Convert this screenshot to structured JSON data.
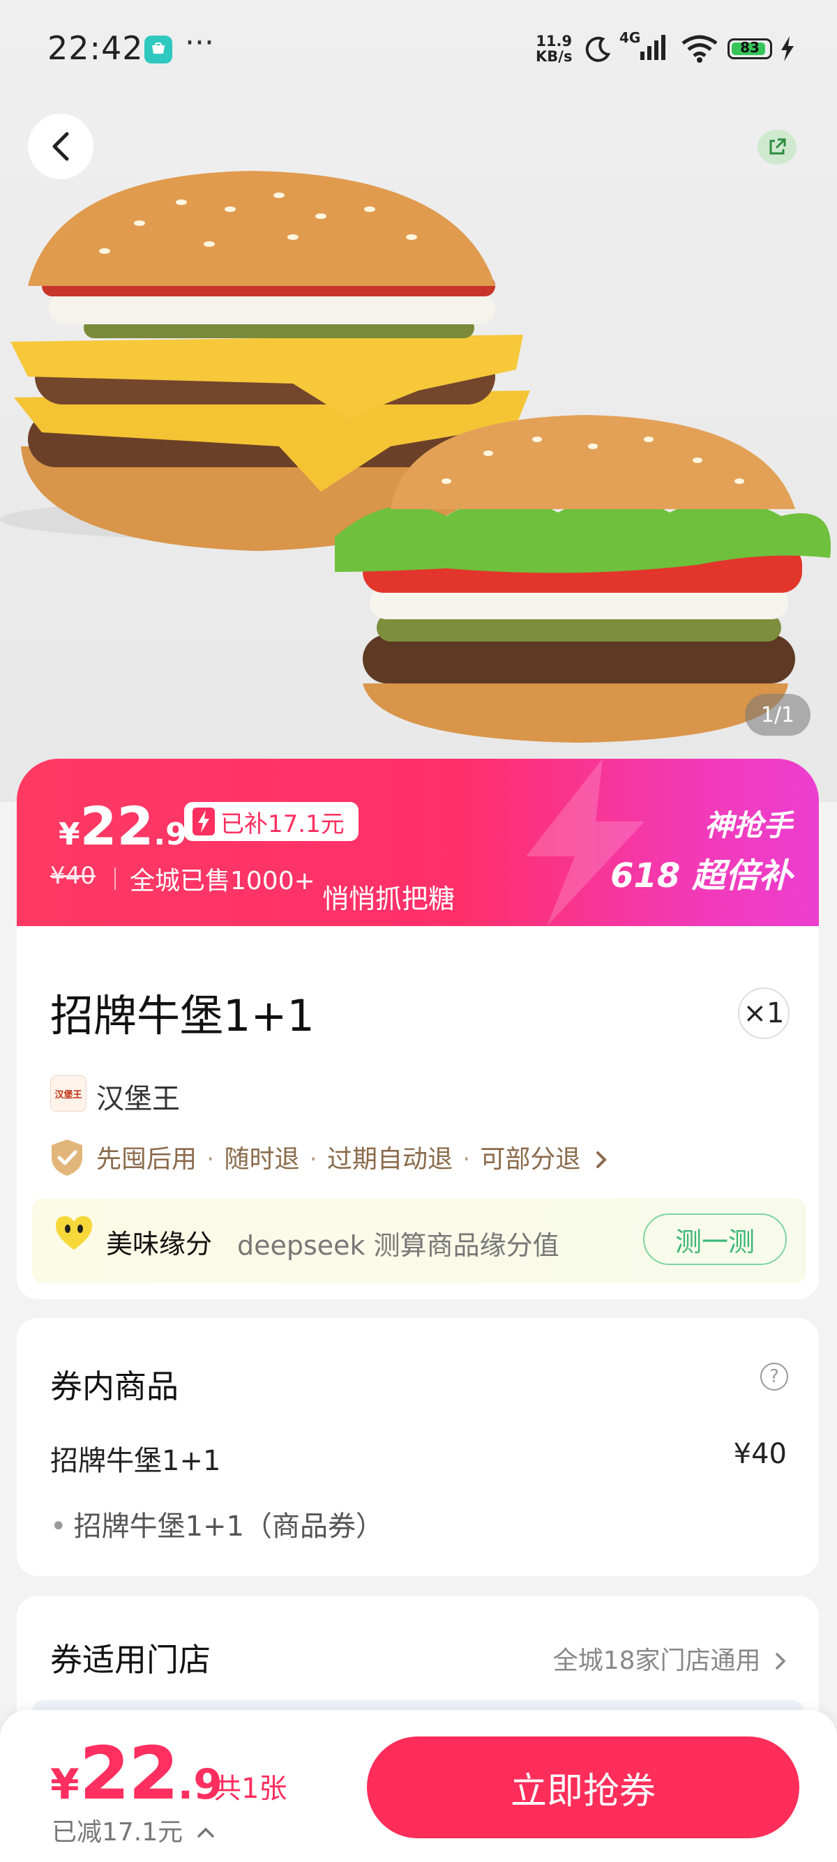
{
  "status_bar": {
    "time": "22:42",
    "dots": "···",
    "net_speed_value": "11.9",
    "net_speed_unit": "KB/s",
    "network": "4G",
    "battery": "83"
  },
  "hero": {
    "image_counter": "1/1"
  },
  "price_banner": {
    "currency": "¥",
    "price_int": "22",
    "price_dec": ".9",
    "subsidy_label": "已补17.1元",
    "original_price": "¥40",
    "sold_text": "全城已售1000+",
    "candy_text": "悄悄抓把糖",
    "promo_title": "神抢手",
    "promo_sub": "618 超倍补"
  },
  "product": {
    "title": "招牌牛堡1+1",
    "quantity": "×1",
    "brand_logo_text": "汉堡王",
    "brand_name": "汉堡王",
    "guarantees": [
      "先囤后用",
      "随时退",
      "过期自动退",
      "可部分退"
    ],
    "fate_title": "美味缘分",
    "fate_desc": "deepseek 测算商品缘分值",
    "fate_button": "测一测"
  },
  "coupon": {
    "title": "券内商品",
    "help": "?",
    "item_name": "招牌牛堡1+1",
    "item_price": "¥40",
    "sub_item": "招牌牛堡1+1（商品券）"
  },
  "stores": {
    "title": "券适用门店",
    "summary": "全城18家门店通用"
  },
  "bottom_bar": {
    "currency": "¥",
    "price_int": "22",
    "price_dec": ".9",
    "count": "共1张",
    "saved": "已减17.1元",
    "buy_button": "立即抢券"
  },
  "colors": {
    "accent": "#ff2d5a",
    "banner_start": "#fe3a62",
    "banner_end": "#ec3ed0",
    "guarantee": "#8a6a4a",
    "fate_button": "#3cb676"
  }
}
